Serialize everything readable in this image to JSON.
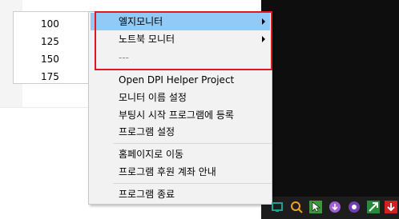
{
  "submenu": {
    "items": [
      "100",
      "125",
      "150",
      "175"
    ]
  },
  "menu": {
    "items": [
      {
        "label": "엘지모니터",
        "has_submenu": true,
        "highlighted": true
      },
      {
        "label": "노트북 모니터",
        "has_submenu": true
      },
      {
        "label": "---",
        "disabled": true
      },
      {
        "label": "Open DPI Helper Project"
      },
      {
        "label": "모니터 이름 설정"
      },
      {
        "label": "부팅시 시작 프로그램에 등록"
      },
      {
        "label": "프로그램 설정"
      },
      {
        "label": "홈페이지로 이동"
      },
      {
        "label": "프로그램 후원 계좌 안내"
      },
      {
        "label": "프로그램 종료"
      }
    ]
  },
  "tray": {
    "icons": [
      "dpi-helper-icon",
      "search-icon",
      "pointer-icon",
      "download-icon",
      "purple-app-icon",
      "chrome-icon",
      "green-arrow-icon",
      "red-download-icon"
    ]
  },
  "colors": {
    "highlight": "#91c9f7",
    "annotation_box": "#e8141e"
  }
}
